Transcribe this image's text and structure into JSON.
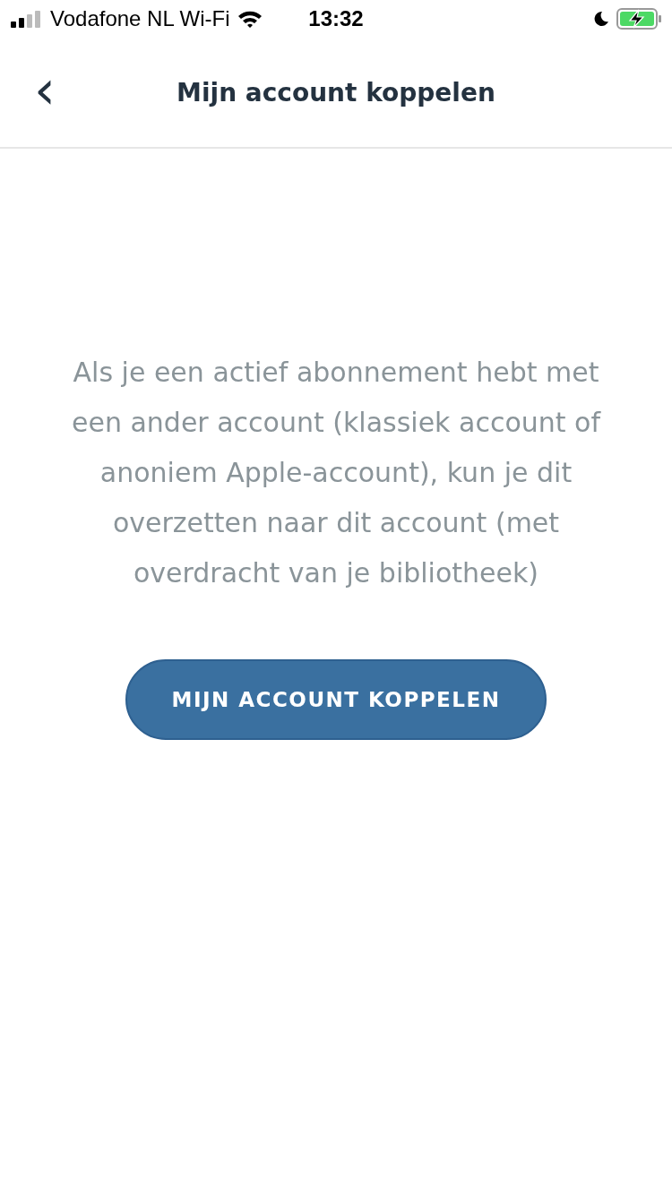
{
  "status_bar": {
    "carrier": "Vodafone NL Wi-Fi",
    "time": "13:32"
  },
  "nav": {
    "back": "‹",
    "title": "Mijn account koppelen"
  },
  "message": "Als je een actief abonnement hebt met een ander account (klassiek account of anoniem Apple-account), kun je dit overzetten naar dit account (met overdracht van je bibliotheek)",
  "button": "MIJN ACCOUNT KOPPELEN"
}
